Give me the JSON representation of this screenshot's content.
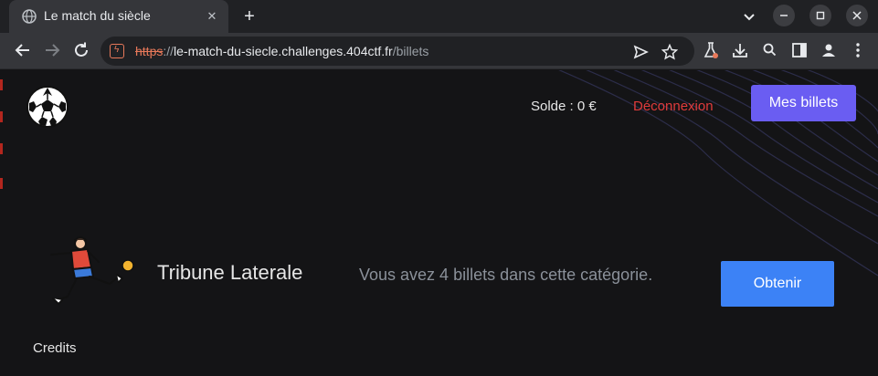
{
  "browser": {
    "tab_title": "Le match du siècle",
    "url": {
      "scheme": "https",
      "separator": "://",
      "host": "le-match-du-siecle.challenges.404ctf.fr",
      "path": "/billets"
    }
  },
  "header": {
    "balance": "Solde : 0 €",
    "logout": "Déconnexion",
    "my_tickets_button": "Mes billets"
  },
  "ticket": {
    "category": "Tribune Laterale",
    "count_text": "Vous avez 4 billets dans cette catégorie.",
    "obtain_button": "Obtenir"
  },
  "footer": {
    "credits": "Credits"
  },
  "colors": {
    "accent_purple": "#6a5df2",
    "button_blue": "#3c82f6",
    "logout_red": "#e03b3b",
    "background": "#141416"
  },
  "icons": [
    "globe-icon",
    "close-icon",
    "plus-icon",
    "chevron-down-icon",
    "back-arrow-icon",
    "forward-arrow-icon",
    "reload-icon",
    "not-secure-icon",
    "send-icon",
    "star-icon",
    "labs-flask-icon",
    "download-icon",
    "zoom-icon",
    "sidepanel-icon",
    "profile-icon",
    "kebab-menu-icon",
    "soccer-ball-logo",
    "soccer-player-illustration"
  ]
}
